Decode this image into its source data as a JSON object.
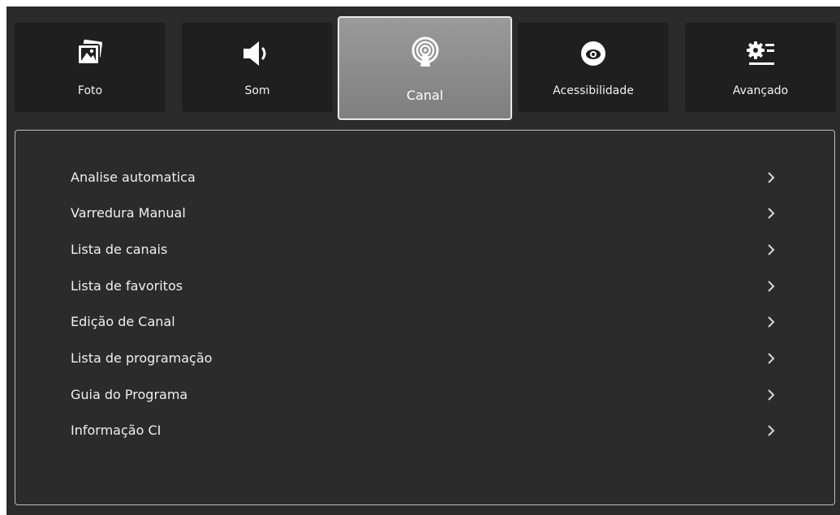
{
  "tabs": [
    {
      "label": "Foto",
      "icon": "image-icon",
      "active": false
    },
    {
      "label": "Som",
      "icon": "speaker-icon",
      "active": false
    },
    {
      "label": "Canal",
      "icon": "antenna-icon",
      "active": true
    },
    {
      "label": "Acessibilidade",
      "icon": "eye-icon",
      "active": false
    },
    {
      "label": "Avançado",
      "icon": "settings-icon",
      "active": false
    }
  ],
  "menu": {
    "items": [
      {
        "label": "Analise automatica",
        "icon": "chevron-right-icon"
      },
      {
        "label": "Varredura Manual",
        "icon": "chevron-right-icon"
      },
      {
        "label": "Lista de canais",
        "icon": "chevron-right-icon"
      },
      {
        "label": "Lista de favoritos",
        "icon": "chevron-right-icon"
      },
      {
        "label": "Edição de Canal",
        "icon": "chevron-right-icon"
      },
      {
        "label": "Lista de programação",
        "icon": "chevron-right-icon"
      },
      {
        "label": "Guia do Programa",
        "icon": "chevron-right-icon"
      },
      {
        "label": "Informação CI",
        "icon": "chevron-right-icon"
      }
    ]
  },
  "colors": {
    "background": "#2b2b2b",
    "tab_background": "#1f1f1f",
    "active_tab": "#8c8c8c",
    "text": "#f0f0f0"
  }
}
